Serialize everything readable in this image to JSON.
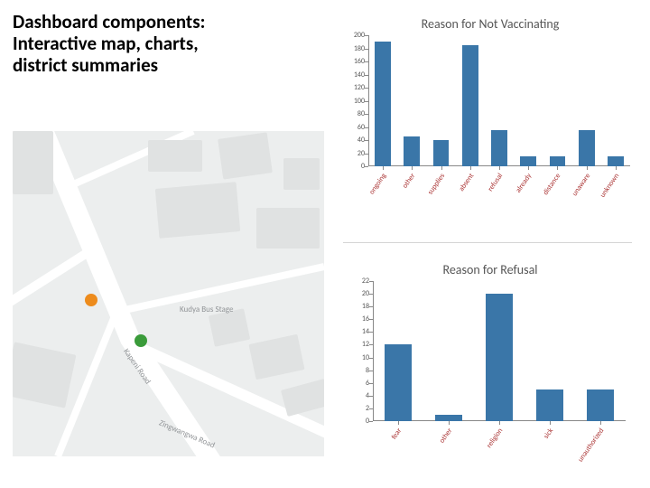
{
  "title_line1": "Dashboard components:",
  "title_line2": "Interactive map, charts,",
  "title_line3": "district summaries",
  "map": {
    "roads": [
      "Kapeni Road",
      "Zingwangwa Road"
    ],
    "label_bus": "Kudya Bus Stage",
    "markers": [
      {
        "name": "orange",
        "color": "#ed8b1c"
      },
      {
        "name": "green",
        "color": "#3a9b3a"
      }
    ]
  },
  "chart_data": [
    {
      "type": "bar",
      "title": "Reason for Not Vaccinating",
      "categories": [
        "ongoing",
        "other",
        "supplies",
        "absent",
        "refusal",
        "already",
        "distance",
        "unaware",
        "unknown"
      ],
      "values": [
        190,
        45,
        40,
        185,
        55,
        15,
        15,
        55,
        15
      ],
      "xlabel": "",
      "ylabel": "",
      "ylim": [
        0,
        200
      ],
      "yticks": [
        0,
        20,
        40,
        60,
        80,
        100,
        120,
        140,
        160,
        180,
        200
      ]
    },
    {
      "type": "bar",
      "title": "Reason for Refusal",
      "categories": [
        "fear",
        "other",
        "religion",
        "sick",
        "unauthorized"
      ],
      "values": [
        12,
        1,
        20,
        5,
        5
      ],
      "xlabel": "",
      "ylabel": "",
      "ylim": [
        0,
        22
      ],
      "yticks": [
        0,
        2,
        4,
        6,
        8,
        10,
        12,
        14,
        16,
        18,
        20,
        22
      ]
    }
  ]
}
